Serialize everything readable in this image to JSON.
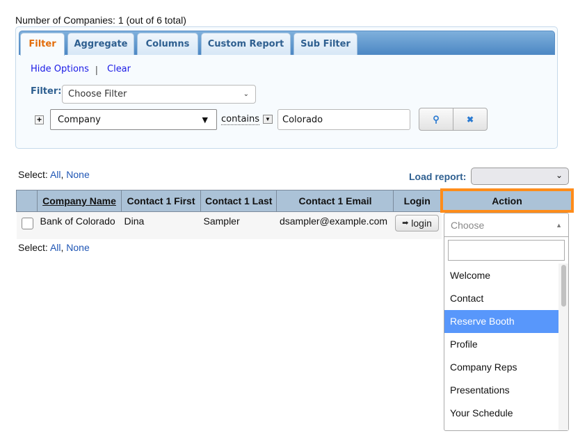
{
  "header": {
    "count_text": "Number of Companies: 1 (out of 6 total)"
  },
  "tabs": [
    {
      "label": "Filter"
    },
    {
      "label": "Aggregate"
    },
    {
      "label": "Columns"
    },
    {
      "label": "Custom Report"
    },
    {
      "label": "Sub Filter"
    }
  ],
  "filter": {
    "hide_options": "Hide Options",
    "separator": "|",
    "clear": "Clear",
    "filter_label": "Filter:",
    "choose_filter": "Choose Filter",
    "field": "Company",
    "operator": "contains",
    "value": "Colorado"
  },
  "select": {
    "label": "Select:",
    "all": "All",
    "none": "None"
  },
  "load_report": {
    "label": "Load report:"
  },
  "table": {
    "headers": [
      "",
      "Company Name",
      "Contact 1 First",
      "Contact 1 Last",
      "Contact 1 Email",
      "Login",
      "Action"
    ],
    "rows": [
      {
        "company": "Bank of Colorado",
        "first": "Dina",
        "last": "Sampler",
        "email": "dsampler@example.com",
        "login": "login"
      }
    ]
  },
  "action_dropdown": {
    "placeholder": "Choose",
    "search": "",
    "options": [
      "Welcome",
      "Contact",
      "Reserve Booth",
      "Profile",
      "Company Reps",
      "Presentations",
      "Your Schedule"
    ],
    "highlighted": "Reserve Booth"
  },
  "colors": {
    "accent_orange": "#ff8c1a",
    "highlight": "#5897fb",
    "header_bg": "#abc2d7"
  }
}
